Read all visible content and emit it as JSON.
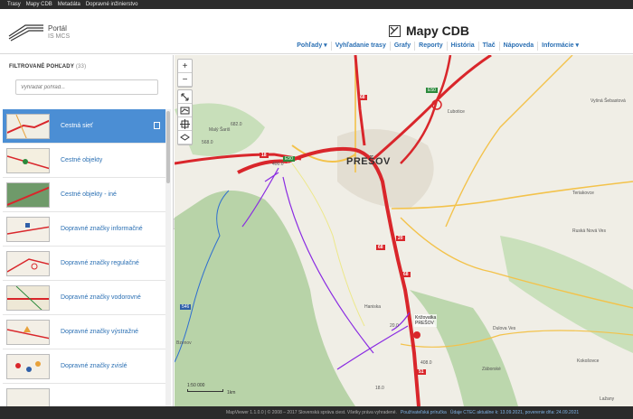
{
  "topbar": {
    "links": [
      "Trasy",
      "Mapy CDB",
      "Metadáta",
      "Dopravné inžinierstvo"
    ]
  },
  "header": {
    "portal_title": "Portál",
    "portal_sub": "IS MCS",
    "app_title": "Mapy CDB",
    "nav": [
      "Pohľady ▾",
      "Vyhľadanie trasy",
      "Grafy",
      "Reporty",
      "História",
      "Tlač",
      "Nápoveda",
      "Informácie ▾"
    ]
  },
  "sidebar": {
    "heading": "FILTROVANÉ POHĽADY",
    "count": "(33)",
    "search_placeholder": "Vyhľadať pohľad...",
    "items": [
      {
        "label": "Cestná sieť",
        "active": true
      },
      {
        "label": "Cestné objekty"
      },
      {
        "label": "Cestné objekty - iné"
      },
      {
        "label": "Dopravné značky informačné"
      },
      {
        "label": "Dopravné značky regulačné"
      },
      {
        "label": "Dopravné značky vodorovné"
      },
      {
        "label": "Dopravné značky výstražné"
      },
      {
        "label": "Dopravné značky zvislé"
      },
      {
        "label": ""
      }
    ]
  },
  "map": {
    "tools_zoom": [
      "+",
      "−"
    ],
    "city": "PREŠOV",
    "places": [
      "Malý Šariš",
      "Ľubotice",
      "Vyšná Šebastová",
      "Teriakovce",
      "Ruská Nová Ves",
      "Haniska",
      "Bzenov",
      "Dulova Ves",
      "Záborské",
      "Kokošovce",
      "Lažany"
    ],
    "road_badges": [
      "68",
      "18",
      "20",
      "68",
      "68",
      "20",
      "51"
    ],
    "green_badges": [
      "E50",
      "E50",
      "E50"
    ],
    "blue_badges": [
      "546"
    ],
    "callout": "Križovatka\nPREŠOV",
    "scale_text": "1:50 000",
    "scale_unit": "1km",
    "numbers": [
      "400.0",
      "682.0",
      "568.0",
      "20.0",
      "408.0",
      "18.0"
    ]
  },
  "footer": {
    "text": "MapViewer 1.1.0.0 | © 2008 – 2017 Slovenská správa ciest. Všetky práva vyhradené.",
    "link1": "Používateľská príručka",
    "link2": "Údaje CTEC aktuálne k: 13.09.2021, poverenie dňa: 24.09.2021"
  },
  "colors": {
    "accent": "#4b8ed4",
    "road": "#d9262b",
    "topbar": "#2b2b2b"
  }
}
